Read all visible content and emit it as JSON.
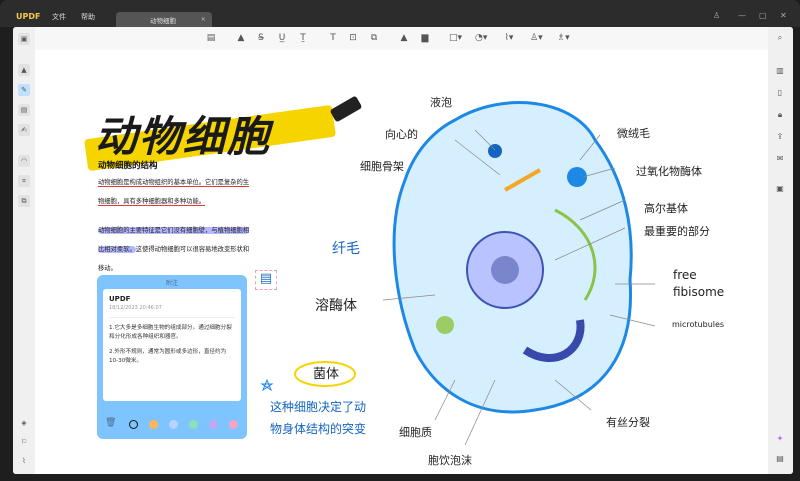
{
  "app": {
    "logo": "UPDF",
    "menu": [
      "文件",
      "帮助"
    ],
    "tab": "动物细胞",
    "tab_close": "×"
  },
  "window": {
    "user": "♙",
    "min": "—",
    "max": "▢",
    "close": "✕"
  },
  "toolbar": [
    "comment-icon",
    "highlight-icon",
    "strikethrough-icon",
    "underline-icon",
    "squiggly-icon",
    "text-icon",
    "textbox-icon",
    "text-callout-icon",
    "pencil-icon",
    "eraser-icon",
    "shape-icon",
    "sticker-icon",
    "attachment-icon",
    "stamp-icon",
    "signature-icon"
  ],
  "doc": {
    "title": "动物细胞",
    "heading": "动物细胞的结构",
    "p1a": "动物细胞是构成动物组织的基本单位。它们是复杂的生",
    "p1b": "物细胞，具有多种细胞器和多种功能。",
    "p2a": "动物细胞的主要特征是它们没有细胞壁，与植物细胞相",
    "p2b_hl": "比相对柔软。",
    "p2b": "这使得动物细胞可以很容易地改变形状和",
    "p2c": "移动。",
    "handnote": [
      "这种细胞决定了动",
      "物身体结构的突变"
    ]
  },
  "note": {
    "header": "附注",
    "author": "UPDF",
    "date": "18/12/2023 20:46:07",
    "line1": "1.它大多是多细胞生物的组成部分。通过细胞分裂和分化形成各种组织和器官。",
    "line2": "2.外形不规则，通常为圆形或多边形，直径约为10-30微米。",
    "colors": [
      "#ffb55a",
      "#b9d4ff",
      "#8fe0b7",
      "#c3a9f0",
      "#f5a3c7"
    ]
  },
  "labels": {
    "vacuole": "液泡",
    "centriole": "向心的",
    "microvilli": "微绒毛",
    "cytoskeleton": "细胞骨架",
    "peroxisome": "过氧化物酶体",
    "golgi": "高尔基体",
    "important": "最重要的部分",
    "cilia": "纤毛",
    "ribosome1": "free",
    "ribosome2": "fibisome",
    "lysosome": "溶酶体",
    "microtubules": "microtubules",
    "bacteria": "菌体",
    "mitosis": "有丝分裂",
    "cytoplasm": "细胞质",
    "pinocytosis": "胞饮泡沫"
  }
}
